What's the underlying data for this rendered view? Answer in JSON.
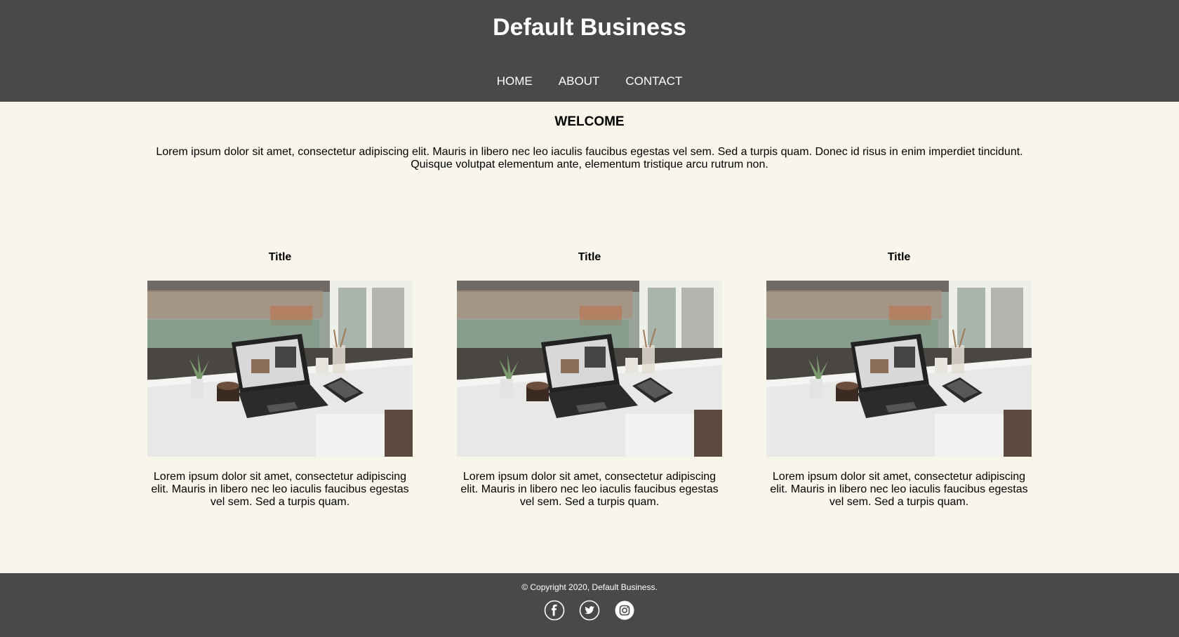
{
  "header": {
    "title": "Default Business",
    "nav": [
      {
        "label": "HOME"
      },
      {
        "label": "ABOUT"
      },
      {
        "label": "CONTACT"
      }
    ]
  },
  "welcome": {
    "heading": "WELCOME",
    "text": "Lorem ipsum dolor sit amet, consectetur adipiscing elit. Mauris in libero nec leo iaculis faucibus egestas vel sem. Sed a turpis quam. Donec id risus in enim imperdiet tincidunt. Quisque volutpat elementum ante, elementum tristique arcu rutrum non."
  },
  "cards": [
    {
      "title": "Title",
      "text": "Lorem ipsum dolor sit amet, consectetur adipiscing elit. Mauris in libero nec leo iaculis faucibus egestas vel sem. Sed a turpis quam."
    },
    {
      "title": "Title",
      "text": "Lorem ipsum dolor sit amet, consectetur adipiscing elit. Mauris in libero nec leo iaculis faucibus egestas vel sem. Sed a turpis quam."
    },
    {
      "title": "Title",
      "text": "Lorem ipsum dolor sit amet, consectetur adipiscing elit. Mauris in libero nec leo iaculis faucibus egestas vel sem. Sed a turpis quam."
    }
  ],
  "footer": {
    "copyright": "© Copyright 2020, Default Business.",
    "social": [
      {
        "icon": "facebook-icon"
      },
      {
        "icon": "twitter-icon"
      },
      {
        "icon": "instagram-icon"
      }
    ]
  },
  "colors": {
    "header_bg": "#494949",
    "page_bg": "#f8f5ea",
    "footer_bg": "#494949",
    "text_light": "#ffffff"
  }
}
